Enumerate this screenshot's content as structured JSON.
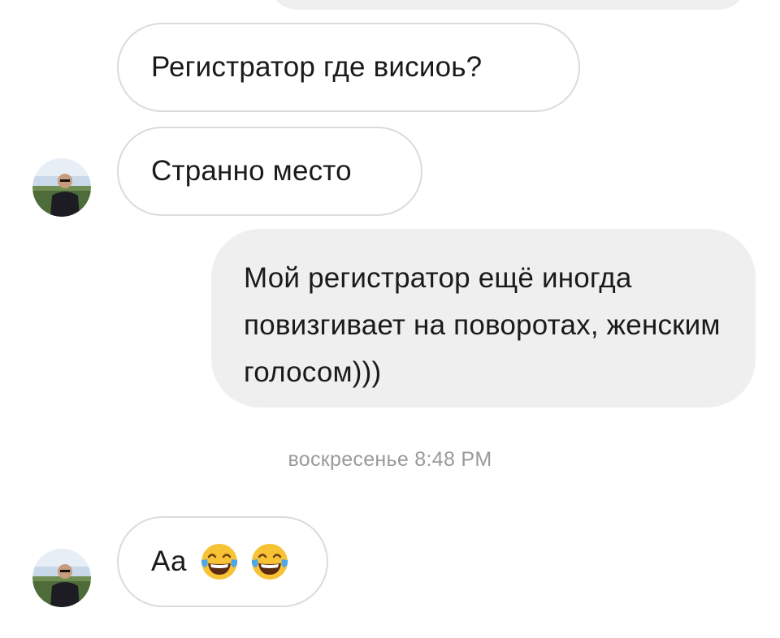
{
  "messages": [
    {
      "text": "Регистратор где висиоь?"
    },
    {
      "text": "Странно место"
    },
    {
      "text": "Мой регистратор ещё иногда повизгивает на поворотах, женским голосом)))"
    },
    {
      "text": "Аа"
    }
  ],
  "timestamp": "воскресенье 8:48 PM",
  "emoji": [
    "face-with-tears-of-joy-icon",
    "face-with-tears-of-joy-icon"
  ],
  "colors": {
    "incoming_bg": "#ffffff",
    "incoming_border": "#dbdbdb",
    "outgoing_bg": "#efefef",
    "timestamp": "#9a9a9a"
  }
}
